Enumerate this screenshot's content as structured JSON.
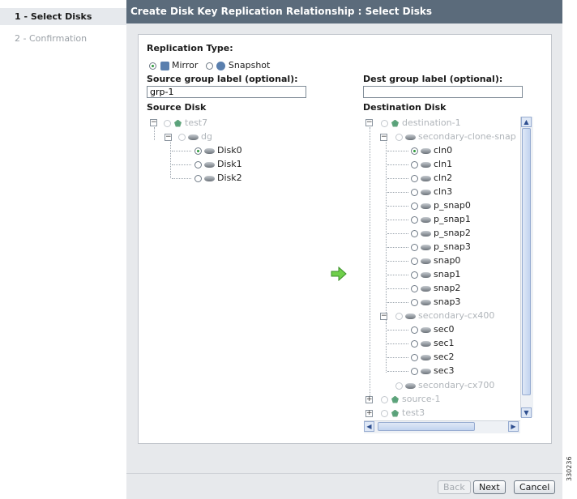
{
  "steps": [
    {
      "label": "1 - Select Disks",
      "active": true
    },
    {
      "label": "2 - Confirmation",
      "active": false
    }
  ],
  "header": {
    "title": "Create Disk Key Replication Relationship : Select Disks"
  },
  "form": {
    "replication_type_label": "Replication Type:",
    "mirror_label": "Mirror",
    "snapshot_label": "Snapshot",
    "selected_type": "Mirror",
    "source_group_label": "Source group label (optional):",
    "source_group_value": "grp-1",
    "dest_group_label": "Dest group label (optional):",
    "dest_group_value": "",
    "source_disk_label": "Source Disk",
    "destination_disk_label": "Destination Disk"
  },
  "source_tree": {
    "root": "test7",
    "group": "dg",
    "disks": [
      "Disk0",
      "Disk1",
      "Disk2"
    ],
    "selected": "Disk0"
  },
  "dest_tree": {
    "root": "destination-1",
    "group1": "secondary-clone-snap",
    "group1_disks": [
      "cln0",
      "cln1",
      "cln2",
      "cln3",
      "p_snap0",
      "p_snap1",
      "p_snap2",
      "p_snap3",
      "snap0",
      "snap1",
      "snap2",
      "snap3"
    ],
    "selected": "cln0",
    "group2": "secondary-cx400",
    "group2_disks": [
      "sec0",
      "sec1",
      "sec2",
      "sec3"
    ],
    "group3": "secondary-cx700",
    "other_roots": [
      "source-1",
      "test3"
    ]
  },
  "buttons": {
    "back": "Back",
    "next": "Next",
    "cancel": "Cancel"
  },
  "figure_id": "330236",
  "colors": {
    "header_bg": "#5b6b7b",
    "main_bg": "#e7e9ec",
    "accent_green": "#2f9a3c"
  }
}
